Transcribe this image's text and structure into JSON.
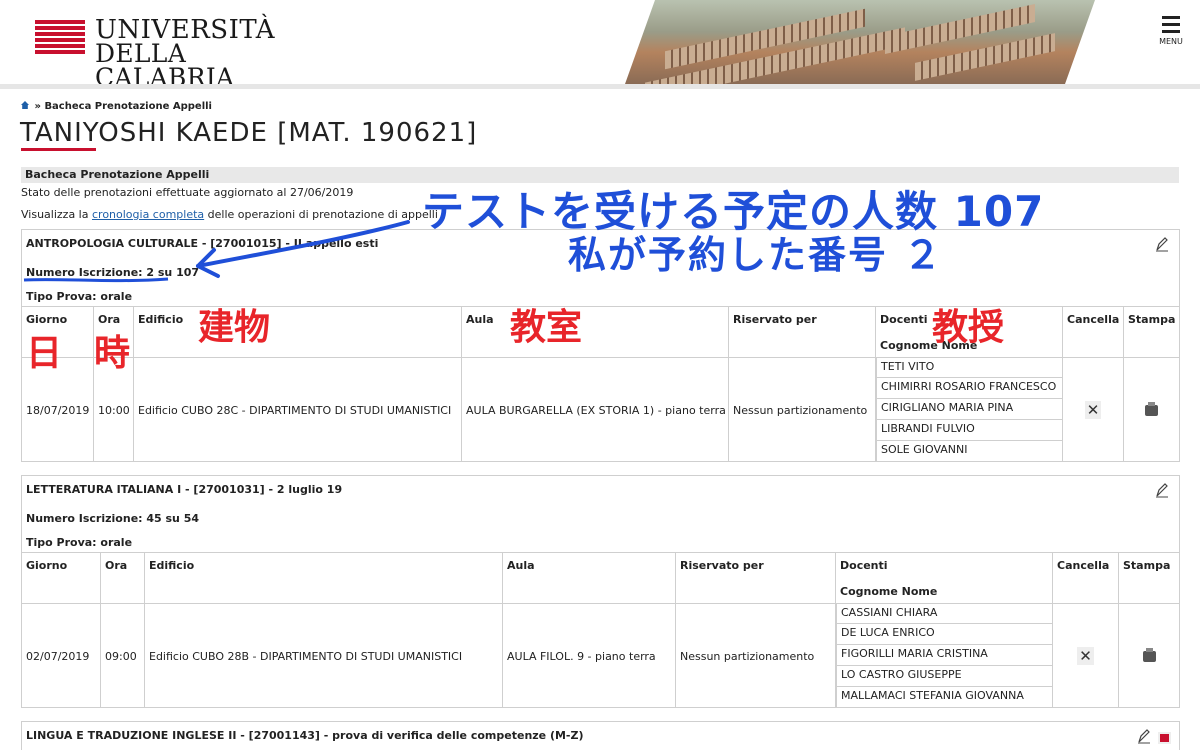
{
  "header": {
    "logo_line1": "UNIVERSITÀ",
    "logo_line2": "DELLA CALABRIA",
    "menu_label": "MENU",
    "brand_color": "#c8102e"
  },
  "breadcrumb": {
    "separator": "»",
    "item": "Bacheca Prenotazione Appelli"
  },
  "page_title": "TANIYOSHI KAEDE [MAT. 190621]",
  "section_title": "Bacheca Prenotazione Appelli",
  "status_text": "Stato delle prenotazioni effettuate aggiornato al 27/06/2019",
  "history": {
    "prefix": "Visualizza la",
    "link": "cronologia completa",
    "suffix": "delle operazioni di prenotazione di appelli"
  },
  "columns": {
    "giorno": "Giorno",
    "ora": "Ora",
    "edificio": "Edificio",
    "aula": "Aula",
    "riservato": "Riservato per",
    "docenti": "Docenti",
    "cognome_nome": "Cognome Nome",
    "cancella": "Cancella",
    "stampa": "Stampa"
  },
  "exams": [
    {
      "title": "ANTROPOLOGIA CULTURALE - [27001015] - II appello esti",
      "numero": "Numero Iscrizione: 2 su 107",
      "tipo": "Tipo Prova: orale",
      "giorno": "18/07/2019",
      "ora": "10:00",
      "edificio": "Edificio CUBO 28C - DIPARTIMENTO DI STUDI UMANISTICI",
      "aula": "AULA BURGARELLA (EX STORIA 1) - piano terra",
      "riservato": "Nessun partizionamento",
      "docenti": [
        "TETI VITO",
        "CHIMIRRI ROSARIO FRANCESCO",
        "CIRIGLIANO MARIA PINA",
        "LIBRANDI FULVIO",
        "SOLE GIOVANNI"
      ]
    },
    {
      "title": "LETTERATURA ITALIANA I - [27001031] - 2 luglio 19",
      "numero": "Numero Iscrizione: 45 su 54",
      "tipo": "Tipo Prova: orale",
      "giorno": "02/07/2019",
      "ora": "09:00",
      "edificio": "Edificio CUBO 28B - DIPARTIMENTO DI STUDI UMANISTICI",
      "aula": "AULA FILOL. 9 - piano terra",
      "riservato": "Nessun partizionamento",
      "docenti": [
        "CASSIANI CHIARA",
        "DE LUCA ENRICO",
        "FIGORILLI MARIA CRISTINA",
        "LO CASTRO GIUSEPPE",
        "MALLAMACI STEFANIA GIOVANNA"
      ]
    },
    {
      "title": "LINGUA E TRADUZIONE INGLESE II - [27001143] - prova di verifica delle competenze (M-Z)"
    }
  ],
  "annotations": {
    "count_text": "テストを受ける予定の人数 107",
    "my_number": "私が予約した番号 ２",
    "day": "日",
    "time": "時",
    "building": "建物",
    "classroom": "教室",
    "professor": "教授",
    "blue_color": "#1f4fd8",
    "red_color": "#e8252a"
  }
}
